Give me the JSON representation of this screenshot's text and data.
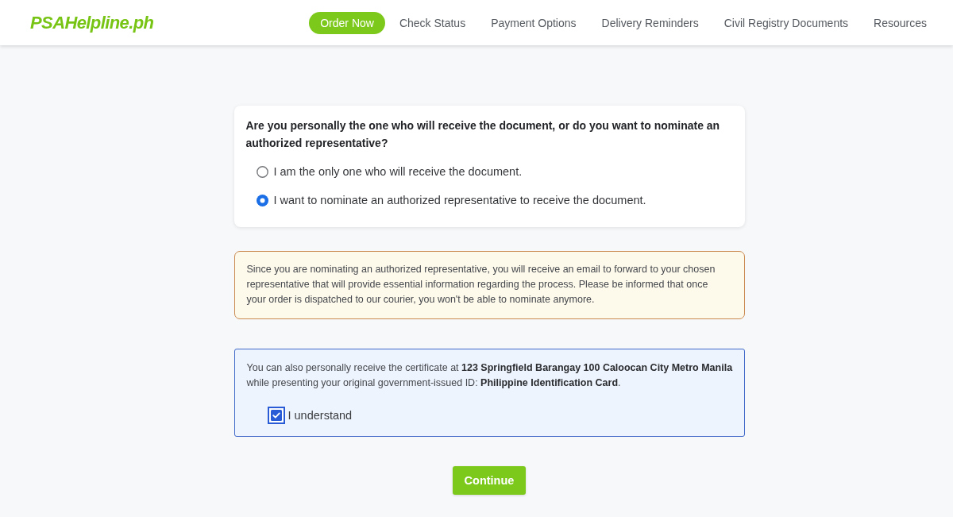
{
  "header": {
    "logo": "PSAHelpline.ph",
    "nav": [
      {
        "label": "Order Now",
        "selected": true
      },
      {
        "label": "Check Status",
        "selected": false
      },
      {
        "label": "Payment Options",
        "selected": false
      },
      {
        "label": "Delivery Reminders",
        "selected": false
      },
      {
        "label": "Civil Registry Documents",
        "selected": false
      },
      {
        "label": "Resources",
        "selected": false
      }
    ]
  },
  "question_card": {
    "question": "Are you personally the one who will receive the document, or do you want to nominate an authorized representative?",
    "options": [
      {
        "label": "I am the only one who will receive the document.",
        "selected": false
      },
      {
        "label": "I want to nominate an authorized representative to receive the document.",
        "selected": true
      }
    ]
  },
  "notices": [
    {
      "kind": "warning",
      "text": "Since you are nominating an authorized representative, you will receive an email to forward to your chosen representative that will provide essential information regarding the process. Please be informed that once your order is dispatched to our courier, you won't be able to nominate anymore."
    },
    {
      "kind": "info",
      "text": "You can also personally receive the certificate at **123 Springfield Barangay 100 Caloocan City Metro Manila** while presenting your original government-issued ID: **Philippine Identification Card**.",
      "checkbox": {
        "label": "I understand",
        "checked": true
      }
    }
  ],
  "continue_button": {
    "label": "Continue"
  }
}
